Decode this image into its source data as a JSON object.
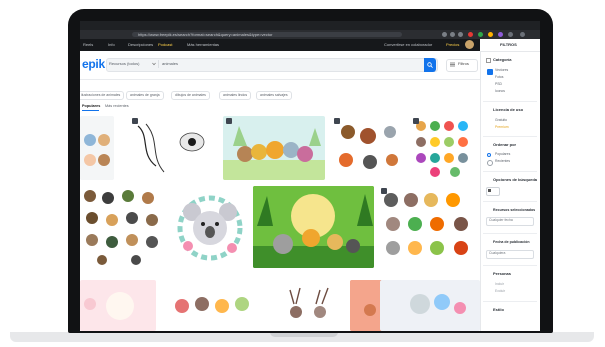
{
  "browser": {
    "url_text": "https://www.freepik.es/search?format=search&query=animales&type=vector"
  },
  "bookmarks": {
    "items": [
      {
        "label": "Reels"
      },
      {
        "label": "Info"
      },
      {
        "label": "Descripciones"
      },
      {
        "label": "Podcast"
      },
      {
        "label": "Más herramientas"
      }
    ],
    "right_items": [
      {
        "label": "Convertirse en colaborador"
      },
      {
        "label": "Precios"
      }
    ]
  },
  "header": {
    "logo": "epik",
    "search_type": "Recursos (todos)",
    "search_query": "animales",
    "filters_label": "Filtros"
  },
  "chips": [
    {
      "label": "ilustraciones de animales"
    },
    {
      "label": "animales de granja"
    },
    {
      "label": "dibujos de animales"
    },
    {
      "label": "animales lindos"
    },
    {
      "label": "animales salvajes"
    }
  ],
  "sort": {
    "active": "Populares",
    "other": "Más recientes"
  },
  "sidebar": {
    "title": "FILTROS",
    "sections": [
      {
        "title": "Categoría",
        "options": [
          "Vectores",
          "Fotos",
          "PSD",
          "Iconos"
        ]
      },
      {
        "title": "Licencia de uso",
        "options": [
          "Gratuito",
          "Premium"
        ]
      },
      {
        "title": "Ordenar por",
        "options": [
          "Populares",
          "Recientes"
        ]
      },
      {
        "title": "Opciones de búsqueda",
        "options": []
      },
      {
        "title": "Recursos seleccionados",
        "options": [
          "Cualquier fecha"
        ]
      },
      {
        "title": "Fecha de publicación",
        "options": [
          "Cualquiera"
        ]
      },
      {
        "title": "Personas",
        "options": [
          "Incluir",
          "Excluir"
        ]
      },
      {
        "title": "Estilo",
        "options": []
      }
    ]
  },
  "colors": {
    "brand": "#1273eb",
    "accent": "#ffd24a"
  },
  "icons": [
    "search-icon",
    "filter-icon",
    "chevron-down-icon",
    "extension-icon",
    "menu-icon"
  ]
}
